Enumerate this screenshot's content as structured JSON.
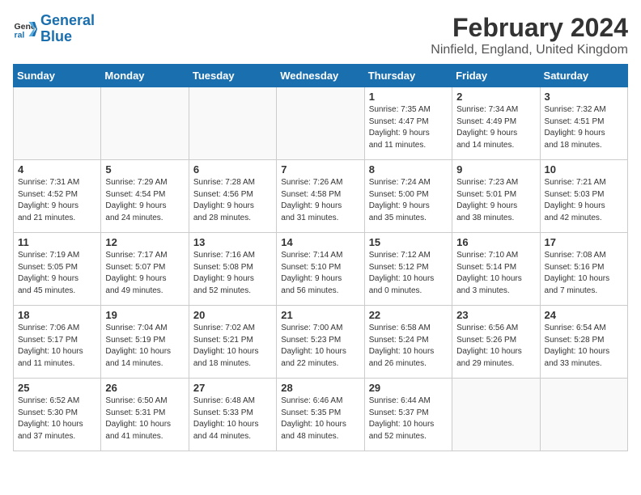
{
  "logo": {
    "line1": "General",
    "line2": "Blue"
  },
  "title": "February 2024",
  "location": "Ninfield, England, United Kingdom",
  "weekdays": [
    "Sunday",
    "Monday",
    "Tuesday",
    "Wednesday",
    "Thursday",
    "Friday",
    "Saturday"
  ],
  "weeks": [
    [
      {
        "day": "",
        "info": ""
      },
      {
        "day": "",
        "info": ""
      },
      {
        "day": "",
        "info": ""
      },
      {
        "day": "",
        "info": ""
      },
      {
        "day": "1",
        "info": "Sunrise: 7:35 AM\nSunset: 4:47 PM\nDaylight: 9 hours\nand 11 minutes."
      },
      {
        "day": "2",
        "info": "Sunrise: 7:34 AM\nSunset: 4:49 PM\nDaylight: 9 hours\nand 14 minutes."
      },
      {
        "day": "3",
        "info": "Sunrise: 7:32 AM\nSunset: 4:51 PM\nDaylight: 9 hours\nand 18 minutes."
      }
    ],
    [
      {
        "day": "4",
        "info": "Sunrise: 7:31 AM\nSunset: 4:52 PM\nDaylight: 9 hours\nand 21 minutes."
      },
      {
        "day": "5",
        "info": "Sunrise: 7:29 AM\nSunset: 4:54 PM\nDaylight: 9 hours\nand 24 minutes."
      },
      {
        "day": "6",
        "info": "Sunrise: 7:28 AM\nSunset: 4:56 PM\nDaylight: 9 hours\nand 28 minutes."
      },
      {
        "day": "7",
        "info": "Sunrise: 7:26 AM\nSunset: 4:58 PM\nDaylight: 9 hours\nand 31 minutes."
      },
      {
        "day": "8",
        "info": "Sunrise: 7:24 AM\nSunset: 5:00 PM\nDaylight: 9 hours\nand 35 minutes."
      },
      {
        "day": "9",
        "info": "Sunrise: 7:23 AM\nSunset: 5:01 PM\nDaylight: 9 hours\nand 38 minutes."
      },
      {
        "day": "10",
        "info": "Sunrise: 7:21 AM\nSunset: 5:03 PM\nDaylight: 9 hours\nand 42 minutes."
      }
    ],
    [
      {
        "day": "11",
        "info": "Sunrise: 7:19 AM\nSunset: 5:05 PM\nDaylight: 9 hours\nand 45 minutes."
      },
      {
        "day": "12",
        "info": "Sunrise: 7:17 AM\nSunset: 5:07 PM\nDaylight: 9 hours\nand 49 minutes."
      },
      {
        "day": "13",
        "info": "Sunrise: 7:16 AM\nSunset: 5:08 PM\nDaylight: 9 hours\nand 52 minutes."
      },
      {
        "day": "14",
        "info": "Sunrise: 7:14 AM\nSunset: 5:10 PM\nDaylight: 9 hours\nand 56 minutes."
      },
      {
        "day": "15",
        "info": "Sunrise: 7:12 AM\nSunset: 5:12 PM\nDaylight: 10 hours\nand 0 minutes."
      },
      {
        "day": "16",
        "info": "Sunrise: 7:10 AM\nSunset: 5:14 PM\nDaylight: 10 hours\nand 3 minutes."
      },
      {
        "day": "17",
        "info": "Sunrise: 7:08 AM\nSunset: 5:16 PM\nDaylight: 10 hours\nand 7 minutes."
      }
    ],
    [
      {
        "day": "18",
        "info": "Sunrise: 7:06 AM\nSunset: 5:17 PM\nDaylight: 10 hours\nand 11 minutes."
      },
      {
        "day": "19",
        "info": "Sunrise: 7:04 AM\nSunset: 5:19 PM\nDaylight: 10 hours\nand 14 minutes."
      },
      {
        "day": "20",
        "info": "Sunrise: 7:02 AM\nSunset: 5:21 PM\nDaylight: 10 hours\nand 18 minutes."
      },
      {
        "day": "21",
        "info": "Sunrise: 7:00 AM\nSunset: 5:23 PM\nDaylight: 10 hours\nand 22 minutes."
      },
      {
        "day": "22",
        "info": "Sunrise: 6:58 AM\nSunset: 5:24 PM\nDaylight: 10 hours\nand 26 minutes."
      },
      {
        "day": "23",
        "info": "Sunrise: 6:56 AM\nSunset: 5:26 PM\nDaylight: 10 hours\nand 29 minutes."
      },
      {
        "day": "24",
        "info": "Sunrise: 6:54 AM\nSunset: 5:28 PM\nDaylight: 10 hours\nand 33 minutes."
      }
    ],
    [
      {
        "day": "25",
        "info": "Sunrise: 6:52 AM\nSunset: 5:30 PM\nDaylight: 10 hours\nand 37 minutes."
      },
      {
        "day": "26",
        "info": "Sunrise: 6:50 AM\nSunset: 5:31 PM\nDaylight: 10 hours\nand 41 minutes."
      },
      {
        "day": "27",
        "info": "Sunrise: 6:48 AM\nSunset: 5:33 PM\nDaylight: 10 hours\nand 44 minutes."
      },
      {
        "day": "28",
        "info": "Sunrise: 6:46 AM\nSunset: 5:35 PM\nDaylight: 10 hours\nand 48 minutes."
      },
      {
        "day": "29",
        "info": "Sunrise: 6:44 AM\nSunset: 5:37 PM\nDaylight: 10 hours\nand 52 minutes."
      },
      {
        "day": "",
        "info": ""
      },
      {
        "day": "",
        "info": ""
      }
    ]
  ]
}
